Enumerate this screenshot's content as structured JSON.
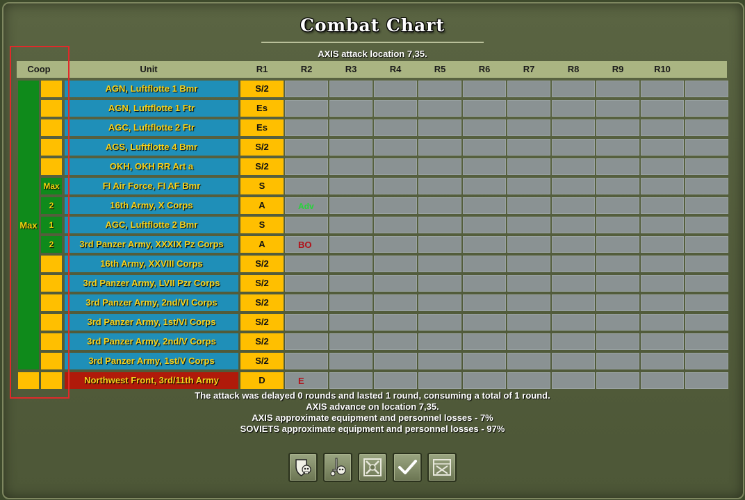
{
  "window": {
    "title": "Combat Chart",
    "subtitle": "AXIS attack location 7,35."
  },
  "table": {
    "headers": {
      "coop": "Coop",
      "unit": "Unit",
      "rounds": [
        "R1",
        "R2",
        "R3",
        "R4",
        "R5",
        "R6",
        "R7",
        "R8",
        "R9",
        "R10"
      ]
    },
    "coop_group_label": "Max",
    "rows": [
      {
        "coop": "",
        "unit": "AGN, Luftflotte 1 Bmr",
        "r1": "S/2",
        "r2": ""
      },
      {
        "coop": "",
        "unit": "AGN, Luftflotte 1 Ftr",
        "r1": "Es",
        "r2": ""
      },
      {
        "coop": "",
        "unit": "AGC, Luftflotte 2 Ftr",
        "r1": "Es",
        "r2": ""
      },
      {
        "coop": "",
        "unit": "AGS, Luftflotte 4 Bmr",
        "r1": "S/2",
        "r2": ""
      },
      {
        "coop": "",
        "unit": "OKH, OKH RR Art a",
        "r1": "S/2",
        "r2": ""
      },
      {
        "coop": "Max",
        "unit": "FI Air Force, FI AF Bmr",
        "r1": "S",
        "r2": ""
      },
      {
        "coop": "2",
        "unit": "16th Army, X Corps",
        "r1": "A",
        "r2": "Adv"
      },
      {
        "coop": "1",
        "unit": "AGC, Luftflotte 2 Bmr",
        "r1": "S",
        "r2": ""
      },
      {
        "coop": "2",
        "unit": "3rd Panzer Army, XXXIX Pz Corps",
        "r1": "A",
        "r2": "BO"
      },
      {
        "coop": "",
        "unit": "16th Army, XXVIII Corps",
        "r1": "S/2",
        "r2": ""
      },
      {
        "coop": "",
        "unit": "3rd Panzer Army, LVII Pzr Corps",
        "r1": "S/2",
        "r2": ""
      },
      {
        "coop": "",
        "unit": "3rd Panzer Army, 2nd/VI Corps",
        "r1": "S/2",
        "r2": ""
      },
      {
        "coop": "",
        "unit": "3rd Panzer Army, 1st/VI Corps",
        "r1": "S/2",
        "r2": ""
      },
      {
        "coop": "",
        "unit": "3rd Panzer Army, 2nd/V Corps",
        "r1": "S/2",
        "r2": ""
      },
      {
        "coop": "",
        "unit": "3rd Panzer Army, 1st/V Corps",
        "r1": "S/2",
        "r2": ""
      },
      {
        "coop": "",
        "unit": "Northwest Front, 3rd/11th Army",
        "r1": "D",
        "r2": "E",
        "enemy": true
      }
    ]
  },
  "summary": [
    "The attack was delayed  0  rounds and lasted  1  round, consuming a total of  1  round.",
    "AXIS advance on location 7,35.",
    "AXIS approximate equipment and personnel losses - 7%",
    "SOVIETS approximate equipment and personnel losses - 97%"
  ],
  "buttons": [
    {
      "name": "shield-skull-button",
      "icon": "shield-skull-icon"
    },
    {
      "name": "sword-skull-button",
      "icon": "sword-skull-icon"
    },
    {
      "name": "crossed-swords-button",
      "icon": "crossed-swords-icon"
    },
    {
      "name": "confirm-button",
      "icon": "checkmark-icon"
    },
    {
      "name": "map-button",
      "icon": "map-cross-icon"
    }
  ],
  "colors": {
    "axis_unit": "#1f8fb8",
    "soviet_unit": "#b01a0a",
    "result_cell": "#ffbf00",
    "coop_group": "#0f8a1b",
    "advance_text": "#26d43a",
    "breakout_text": "#b1121a",
    "selection_outline": "#e02a2a"
  }
}
